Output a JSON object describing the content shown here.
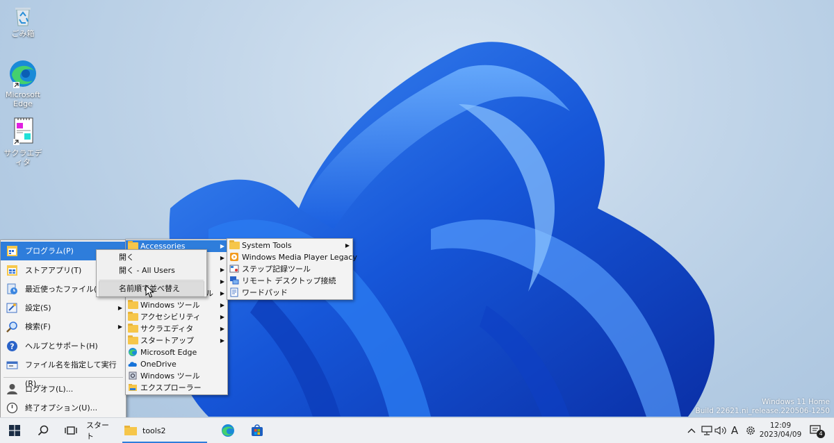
{
  "desktop": {
    "icons": [
      {
        "label": "ごみ箱"
      },
      {
        "label": "Microsoft Edge"
      },
      {
        "label": "サクラエディタ"
      }
    ],
    "watermark": {
      "line1": "Windows 11 Home",
      "line2": "Build 22621.ni_release.220506-1250"
    }
  },
  "start_menu": {
    "items": [
      {
        "label": "プログラム(P)",
        "icon": "programs-icon",
        "submenu": true
      },
      {
        "label": "ストアアプリ(T)",
        "icon": "store-apps-icon",
        "submenu": false
      },
      {
        "label": "最近使ったファイル(D)",
        "icon": "recent-files-icon",
        "submenu": true
      },
      {
        "label": "設定(S)",
        "icon": "settings-icon",
        "submenu": true
      },
      {
        "label": "検索(F)",
        "icon": "search-icon",
        "submenu": true
      },
      {
        "label": "ヘルプとサポート(H)",
        "icon": "help-icon",
        "submenu": false
      },
      {
        "label": "ファイル名を指定して実行(R)...",
        "icon": "run-icon",
        "submenu": false
      },
      {
        "label": "ログオフ(L)...",
        "icon": "user-icon",
        "submenu": false
      },
      {
        "label": "終了オプション(U)...",
        "icon": "power-icon",
        "submenu": false
      }
    ]
  },
  "programs_menu": {
    "items": [
      {
        "label": "Accessories",
        "icon": "folder-icon",
        "submenu": true
      },
      {
        "label": "",
        "icon": "folder-icon",
        "submenu": true
      },
      {
        "label": "",
        "icon": "folder-icon",
        "submenu": true
      },
      {
        "label": "",
        "icon": "folder-icon",
        "submenu": true
      },
      {
        "label": "ル",
        "icon": "folder-icon",
        "submenu": true
      },
      {
        "label": "Windows ツール",
        "icon": "folder-icon",
        "submenu": true
      },
      {
        "label": "アクセシビリティ",
        "icon": "folder-icon",
        "submenu": true
      },
      {
        "label": "サクラエディタ",
        "icon": "folder-icon",
        "submenu": true
      },
      {
        "label": "スタートアップ",
        "icon": "folder-icon",
        "submenu": true
      },
      {
        "label": "Microsoft Edge",
        "icon": "edge-icon",
        "submenu": false
      },
      {
        "label": "OneDrive",
        "icon": "onedrive-icon",
        "submenu": false
      },
      {
        "label": "Windows ツール",
        "icon": "tools-icon",
        "submenu": false
      },
      {
        "label": "エクスプローラー",
        "icon": "explorer-icon",
        "submenu": false
      }
    ]
  },
  "accessories_menu": {
    "items": [
      {
        "label": "System Tools",
        "icon": "folder-icon",
        "submenu": true
      },
      {
        "label": "Windows Media Player Legacy",
        "icon": "media-player-icon",
        "submenu": false
      },
      {
        "label": "ステップ記録ツール",
        "icon": "steps-recorder-icon",
        "submenu": false
      },
      {
        "label": "リモート デスクトップ接続",
        "icon": "remote-desktop-icon",
        "submenu": false
      },
      {
        "label": "ワードパッド",
        "icon": "wordpad-icon",
        "submenu": false
      }
    ]
  },
  "context_menu": {
    "items": [
      {
        "label": "開く"
      },
      {
        "label": "開く - All Users"
      },
      {
        "label": "名前順で並べ替え"
      }
    ]
  },
  "taskbar": {
    "start_label": "スタート",
    "active_window": "tools2",
    "ime_mode": "A",
    "time": "12:09",
    "date": "2023/04/09",
    "notification_count": "4"
  },
  "colors": {
    "highlight": "#2e7ddb",
    "menu_bg": "#f3f3f3",
    "taskbar_bg": "#eef0f3"
  }
}
